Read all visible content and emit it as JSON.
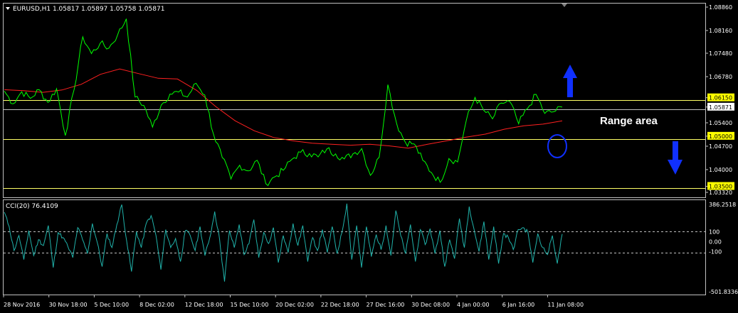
{
  "main_panel": {
    "header": "EURUSD,H1  1.05817 1.05897 1.05758 1.05871",
    "annotation": "Range area",
    "price_labels": [
      "1.08860",
      "1.08160",
      "1.07480",
      "1.06780",
      "1.06150",
      "1.05871",
      "1.05400",
      "1.05000",
      "1.04700",
      "1.04000",
      "1.03500",
      "1.03320"
    ],
    "highlighted_labels": [
      "1.06150",
      "1.05000",
      "1.03500"
    ]
  },
  "indicator_panel": {
    "header": "CCI(20) 76.4109",
    "scale_labels": [
      "386.2518",
      "100",
      "0.00",
      "-100",
      "-501.8336"
    ]
  },
  "time_axis": [
    "28 Nov 2016",
    "30 Nov 18:00",
    "5 Dec 10:00",
    "8 Dec 02:00",
    "12 Dec 18:00",
    "15 Dec 10:00",
    "20 Dec 02:00",
    "22 Dec 18:00",
    "27 Dec 16:00",
    "30 Dec 08:00",
    "4 Jan 00:00",
    "6 Jan 16:00",
    "11 Jan 08:00"
  ],
  "colors": {
    "background": "#000000",
    "price_line": "#00ff00",
    "moving_average": "#ff2020",
    "horizontal_levels": "#ffff66",
    "current_price_line": "#c0c0c0",
    "cci_line": "#20b2aa",
    "arrows": "#1030ff",
    "circle": "#1030ff",
    "label_highlight": "#ffff00"
  },
  "icons": [
    "arrow-up-icon",
    "arrow-down-icon",
    "circle-marker-icon",
    "dropdown-triangle-icon"
  ],
  "chart_data": [
    {
      "type": "line",
      "title": "EURUSD,H1",
      "ohlc_last": {
        "open": 1.05817,
        "high": 1.05897,
        "low": 1.05758,
        "close": 1.05871
      },
      "x": [
        "28 Nov 2016",
        "30 Nov 18:00",
        "5 Dec 10:00",
        "8 Dec 02:00",
        "12 Dec 18:00",
        "15 Dec 10:00",
        "20 Dec 02:00",
        "22 Dec 18:00",
        "27 Dec 16:00",
        "30 Dec 08:00",
        "4 Jan 00:00",
        "6 Jan 16:00",
        "11 Jan 08:00"
      ],
      "ylim": [
        1.0332,
        1.0886
      ],
      "horizontal_levels": [
        1.0615,
        1.05,
        1.035
      ],
      "current_price": 1.05871,
      "series": [
        {
          "values": [
            1.0635,
            1.0597,
            1.0633,
            1.0613,
            1.0639,
            1.0601,
            1.0642,
            1.0502,
            1.0638,
            1.0797,
            1.0747,
            1.0778,
            1.0763,
            1.0803,
            1.0851,
            1.0617,
            1.0592,
            1.0527,
            1.0593,
            1.0626,
            1.0632,
            1.0617,
            1.0658,
            1.0623,
            1.0506,
            1.0436,
            1.0372,
            1.0413,
            1.0396,
            1.0428,
            1.0358,
            1.0378,
            1.0398,
            1.0431,
            1.0452,
            1.0448,
            1.0438,
            1.0462,
            1.0447,
            1.0432,
            1.0447,
            1.0463,
            1.0383,
            1.0437,
            1.0654,
            1.0538,
            1.0482,
            1.0477,
            1.0428,
            1.0391,
            1.0362,
            1.0433,
            1.0423,
            1.0548,
            1.0616,
            1.0577,
            1.0552,
            1.0599,
            1.0603,
            1.0537,
            1.0582,
            1.0625,
            1.0568,
            1.0573,
            1.0587
          ]
        },
        {
          "values": [
            1.0639,
            1.0636,
            1.0631,
            1.0638,
            1.0655,
            1.0685,
            1.0701,
            1.0687,
            1.0673,
            1.0671,
            1.0637,
            1.0588,
            1.0546,
            1.0516,
            1.0496,
            1.0486,
            1.0479,
            1.0476,
            1.0473,
            1.0476,
            1.0471,
            1.0464,
            1.0476,
            1.0486,
            1.0497,
            1.0506,
            1.0521,
            1.0531,
            1.0536,
            1.0546
          ]
        }
      ]
    },
    {
      "type": "line",
      "title": "CCI(20)",
      "ylim": [
        -501.8336,
        386.2518
      ],
      "reference_levels": [
        100,
        0,
        -100
      ],
      "last_value": 76.4109,
      "series": [
        {
          "values": [
            295,
            150,
            -90,
            60,
            -180,
            110,
            -140,
            20,
            -40,
            160,
            -260,
            90,
            40,
            -50,
            -160,
            140,
            20,
            -120,
            180,
            -10,
            -250,
            80,
            -60,
            170,
            370,
            10,
            -300,
            100,
            -60,
            180,
            260,
            60,
            -280,
            120,
            -60,
            30,
            -200,
            110,
            60,
            -90,
            150,
            -140,
            40,
            300,
            20,
            -400,
            110,
            -60,
            170,
            -130,
            -20,
            220,
            -160,
            90,
            -20,
            140,
            -210,
            60,
            -110,
            180,
            -40,
            160,
            -200,
            40,
            -90,
            120,
            -110,
            150,
            -120,
            90,
            380,
            -180,
            160,
            -260,
            150,
            -150,
            70,
            -80,
            160,
            -140,
            310,
            60,
            -120,
            170,
            -200,
            120,
            -30,
            130,
            -120,
            110,
            -250,
            20,
            -170,
            230,
            -60,
            350,
            120,
            -100,
            200,
            -180,
            150,
            -220,
            80,
            40,
            -80,
            120,
            140,
            90,
            -210,
            80,
            -60,
            -130,
            60,
            -220,
            76
          ]
        }
      ]
    }
  ]
}
